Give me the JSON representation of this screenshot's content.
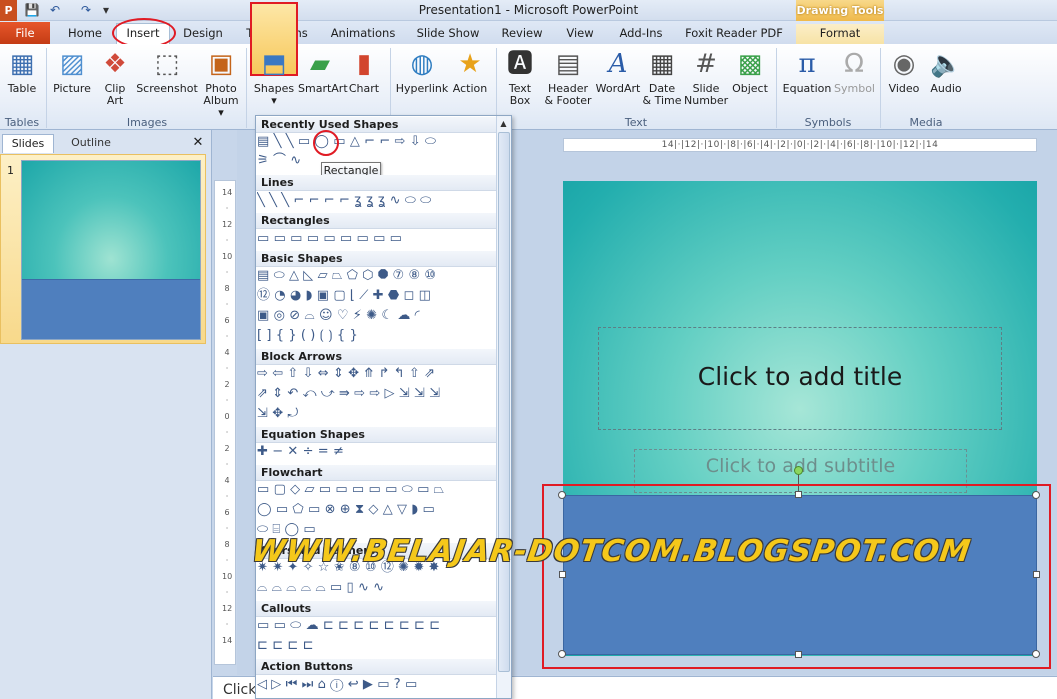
{
  "window": {
    "title": "Presentation1 - Microsoft PowerPoint",
    "context_tab": "Drawing Tools"
  },
  "quick_access": {
    "save": "💾",
    "undo": "↶",
    "redo": "↷",
    "customize": "▾"
  },
  "tabs": [
    {
      "label": "File"
    },
    {
      "label": "Home"
    },
    {
      "label": "Insert"
    },
    {
      "label": "Design"
    },
    {
      "label": "Transitions"
    },
    {
      "label": "Animations"
    },
    {
      "label": "Slide Show"
    },
    {
      "label": "Review"
    },
    {
      "label": "View"
    },
    {
      "label": "Add-Ins"
    },
    {
      "label": "Foxit Reader PDF"
    },
    {
      "label": "Format"
    }
  ],
  "ribbon": {
    "buttons": {
      "table": "Table",
      "picture": "Picture",
      "clip_art_1": "Clip",
      "clip_art_2": "Art",
      "screenshot": "Screenshot",
      "photo_album_1": "Photo",
      "photo_album_2": "Album ▾",
      "shapes": "Shapes",
      "shapes_arrow": "▾",
      "smartart": "SmartArt",
      "chart": "Chart",
      "hyperlink": "Hyperlink",
      "action": "Action",
      "text_box_1": "Text",
      "text_box_2": "Box",
      "header_footer_1": "Header",
      "header_footer_2": "& Footer",
      "wordart": "WordArt",
      "date_time_1": "Date",
      "date_time_2": "& Time",
      "slide_number_1": "Slide",
      "slide_number_2": "Number",
      "object": "Object",
      "equation": "Equation",
      "symbol": "Symbol",
      "video": "Video",
      "audio": "Audio"
    },
    "groups": {
      "tables": "Tables",
      "images": "Images",
      "text": "Text",
      "symbols": "Symbols",
      "media": "Media"
    }
  },
  "left_panel": {
    "tab_slides": "Slides",
    "tab_outline": "Outline",
    "close": "✕",
    "slide_number": "1"
  },
  "hruler": "14|·|12|·|10|·|8|·|6|·|4|·|2|·|0|·|2|·|4|·|6|·|8|·|10|·|12|·|14",
  "vruler": [
    "14",
    "·",
    "12",
    "·",
    "10",
    "·",
    "8",
    "·",
    "6",
    "·",
    "4",
    "·",
    "2",
    "·",
    "0",
    "·",
    "2",
    "·",
    "4",
    "·",
    "6",
    "·",
    "8",
    "·",
    "10",
    "·",
    "12",
    "·",
    "14"
  ],
  "slide": {
    "title_placeholder": "Click to add title",
    "subtitle_placeholder": "Click to add subtitle"
  },
  "notes": {
    "placeholder": "Click"
  },
  "shapes_menu": {
    "sections": {
      "recent": "Recently Used Shapes",
      "lines": "Lines",
      "rectangles": "Rectangles",
      "basic": "Basic Shapes",
      "block_arrows": "Block Arrows",
      "equation": "Equation Shapes",
      "flowchart": "Flowchart",
      "stars": "Stars and Banners",
      "callouts": "Callouts",
      "action": "Action Buttons"
    },
    "rows": {
      "recent1": "▤╲╲▭◯▭△⌐⌐⇨⇩⬭",
      "recent2": "⚞⌒∿",
      "lines1": "╲╲╲⌐⌐⌐⌐ʓʓʓ∿⬭⬭",
      "rects1": "▭▭▭▭▭▭▭▭▭",
      "basic1": "▤⬭△◺▱⏢⬠⬡⯃⑦⑧⑩",
      "basic2": "⑫◔◕◗▣▢⌊⟋✚⬣◻◫",
      "basic3": "▣◎⊘⌓☺♡⚡✺☾☁◜",
      "basic4": "[]{}()⟮⟯{}",
      "arrows1": "⇨⇦⇧⇩⇔⇕✥⤊↱↰⇧⇗",
      "arrows2": "⇗⇕↶⤺⤻⇛⇨⇨▷⇲⇲⇲",
      "arrows3": "⇲✥⤾",
      "eq1": "✚−✕÷=≠",
      "flow1": "▭▢◇▱▭▭▭▭▭⬭▭⏢",
      "flow2": "◯▭⬠▭⊗⊕⧗◇△▽◗▭",
      "flow3": "⬭⌸◯▭",
      "stars1": "✷✷✦✧☆✬⑧⑩⑫✺✹✸",
      "stars2": "⌓⌓⌓⌓⌓▭▯∿∿",
      "callouts1": "▭▭⬭☁⊏⊏⊏⊏⊏⊏⊏⊏",
      "callouts2": "⊏⊏⊏⊏",
      "action1": "◁▷⏮⏭⌂ⓘ↩▶▭?▭"
    },
    "tooltip": "Rectangle"
  },
  "watermark": "WWW.BELAJAR-DOTCOM.BLOGSPOT.COM",
  "colors": {
    "accent_red": "#e01b24",
    "blue_rect": "#4f7fbe",
    "teal": "#23aeae",
    "file_tab": "#c94f1f",
    "drawing_tools": "#efb94a"
  }
}
